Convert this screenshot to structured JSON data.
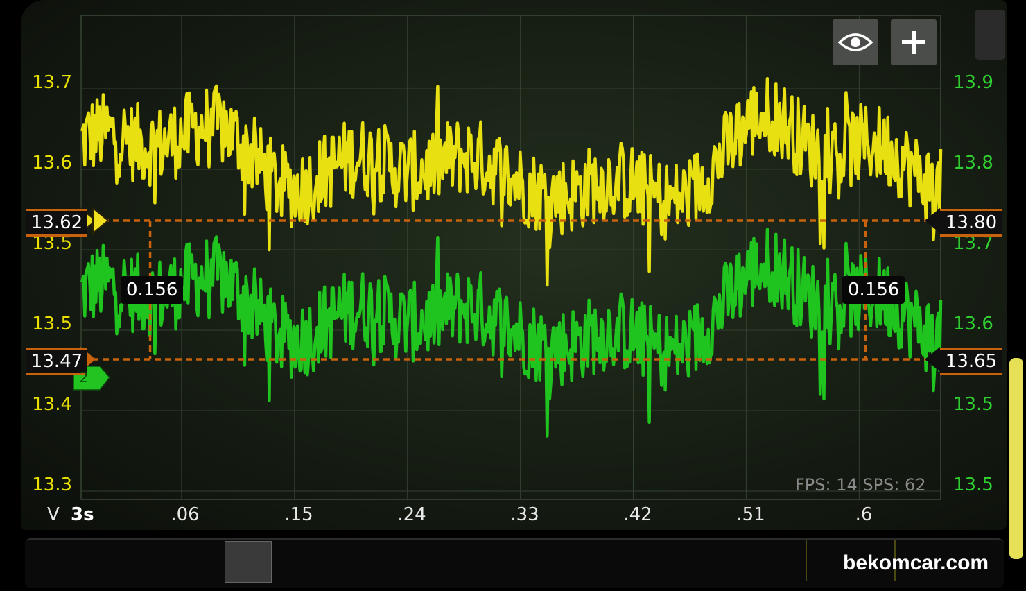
{
  "chart_data": {
    "type": "line",
    "x_start_label": "3s",
    "x_ticks": [
      ".06",
      ".15",
      ".24",
      ".33",
      ".42",
      ".51",
      ".6"
    ],
    "x_tick_values": [
      0.06,
      0.15,
      0.24,
      0.33,
      0.42,
      0.51,
      0.6
    ],
    "xlim": [
      -0.02,
      0.665
    ],
    "x_axis_label": "V",
    "left_axis": {
      "ticks": [
        "13.7",
        "13.6",
        "13.5",
        "13.5",
        "13.4",
        "13.3"
      ]
    },
    "right_axis": {
      "ticks": [
        "13.9",
        "13.8",
        "13.7",
        "13.6",
        "13.5",
        "13.5"
      ]
    },
    "series": [
      {
        "color": "#e8e010",
        "mean": 13.62,
        "approx_range": [
          13.5,
          13.7
        ],
        "marker_value": "13.62",
        "right_marker_value": "13.80"
      },
      {
        "color": "#1fc41f",
        "mean": 13.47,
        "approx_range": [
          13.35,
          13.57
        ],
        "marker_value": "13.47",
        "right_marker_value": "13.65",
        "marker_badge": "2"
      }
    ],
    "cursor_deltas": [
      "0.156",
      "0.156"
    ],
    "cursor_x": [
      0.035,
      0.605
    ],
    "grid": true
  },
  "status": {
    "fps": "FPS: 14  SPS: 62"
  },
  "watermark": "bekomcar.com",
  "colors": {
    "yellow": "#e8e010",
    "green": "#1fc41f",
    "marker_orange": "#c8620c",
    "grid": "#3a4a36"
  },
  "icons": {
    "view": "eye-icon",
    "add": "plus-icon"
  }
}
